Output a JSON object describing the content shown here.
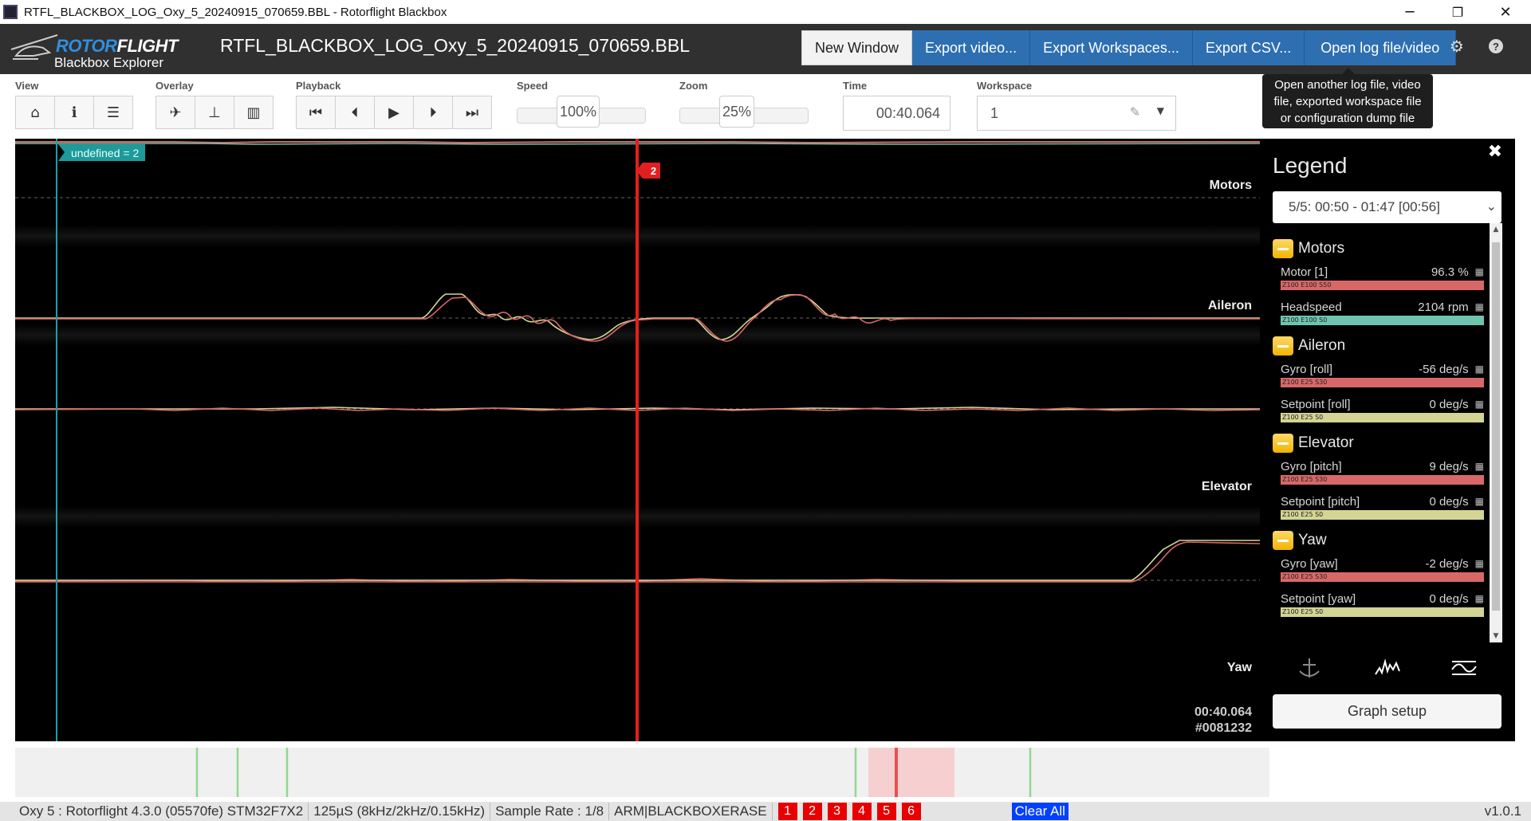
{
  "window": {
    "title": "RTFL_BLACKBOX_LOG_Oxy_5_20240915_070659.BBL - Rotorflight Blackbox",
    "minimize": "─",
    "maximize": "❐",
    "close": "✕"
  },
  "header": {
    "brand_part1": "ROTOR",
    "brand_part2": "FLIGHT",
    "subtitle": "Blackbox Explorer",
    "filename": "RTFL_BLACKBOX_LOG_Oxy_5_20240915_070659.BBL",
    "buttons": {
      "new_window": "New Window",
      "export_video": "Export video...",
      "export_workspaces": "Export Workspaces...",
      "export_csv": "Export CSV...",
      "open_log": "Open log file/video"
    },
    "settings_icon": "gear-icon",
    "help_icon": "help-icon"
  },
  "tooltip": {
    "text1": "Open another log file, video",
    "text2": "file, exported workspace file",
    "text3": "or configuration dump file"
  },
  "toolbar": {
    "view_label": "View",
    "overlay_label": "Overlay",
    "playback_label": "Playback",
    "speed_label": "Speed",
    "speed_value": "100%",
    "speed_fraction": 0.31,
    "zoom_label": "Zoom",
    "zoom_value": "25%",
    "zoom_fraction": 0.31,
    "time_label": "Time",
    "time_value": "00:40.064",
    "workspace_label": "Workspace",
    "workspace_value": "1"
  },
  "graph": {
    "marker_label": "undefined = 2",
    "cursor_tag": "2",
    "group_labels": {
      "motors": "Motors",
      "aileron": "Aileron",
      "elevator": "Elevator",
      "yaw": "Yaw"
    },
    "time_readout": "00:40.064",
    "frame_readout": "#0081232"
  },
  "legend": {
    "title": "Legend",
    "close": "✖",
    "log_selector": "5/5: 00:50 - 01:47 [00:56]",
    "groups": [
      {
        "name": "Motors",
        "fields": [
          {
            "name": "Motor [1]",
            "value": "96.3 %",
            "bar": "Z100 E100 S50",
            "color": "#d86868"
          },
          {
            "name": "Headspeed",
            "value": "2104 rpm",
            "bar": "Z100 E100 S0",
            "color": "#6fc4b0"
          }
        ]
      },
      {
        "name": "Aileron",
        "fields": [
          {
            "name": "Gyro [roll]",
            "value": "-56 deg/s",
            "bar": "Z100 E25 S30",
            "color": "#d86868"
          },
          {
            "name": "Setpoint [roll]",
            "value": "0 deg/s",
            "bar": "Z100 E25 S0",
            "color": "#d4d494"
          }
        ]
      },
      {
        "name": "Elevator",
        "fields": [
          {
            "name": "Gyro [pitch]",
            "value": "9 deg/s",
            "bar": "Z100 E25 S30",
            "color": "#d86868"
          },
          {
            "name": "Setpoint [pitch]",
            "value": "0 deg/s",
            "bar": "Z100 E25 S0",
            "color": "#d4d494"
          }
        ]
      },
      {
        "name": "Yaw",
        "fields": [
          {
            "name": "Gyro [yaw]",
            "value": "-2 deg/s",
            "bar": "Z100 E25 S30",
            "color": "#d86868"
          },
          {
            "name": "Setpoint [yaw]",
            "value": "0 deg/s",
            "bar": "Z100 E25 S0",
            "color": "#d4d494"
          }
        ]
      }
    ],
    "graph_setup": "Graph setup"
  },
  "statusbar": {
    "craft_info": "Oxy 5 : Rotorflight 4.3.0 (05570fe) STM32F7X2",
    "loop_time": "125µS (8kHz/2kHz/0.15kHz)",
    "sample_rate": "Sample Rate : 1/8",
    "flags": "ARM|BLACKBOXERASE",
    "markers": [
      "1",
      "2",
      "3",
      "4",
      "5",
      "6"
    ],
    "clear_all": "Clear All",
    "version": "v1.0.1"
  }
}
